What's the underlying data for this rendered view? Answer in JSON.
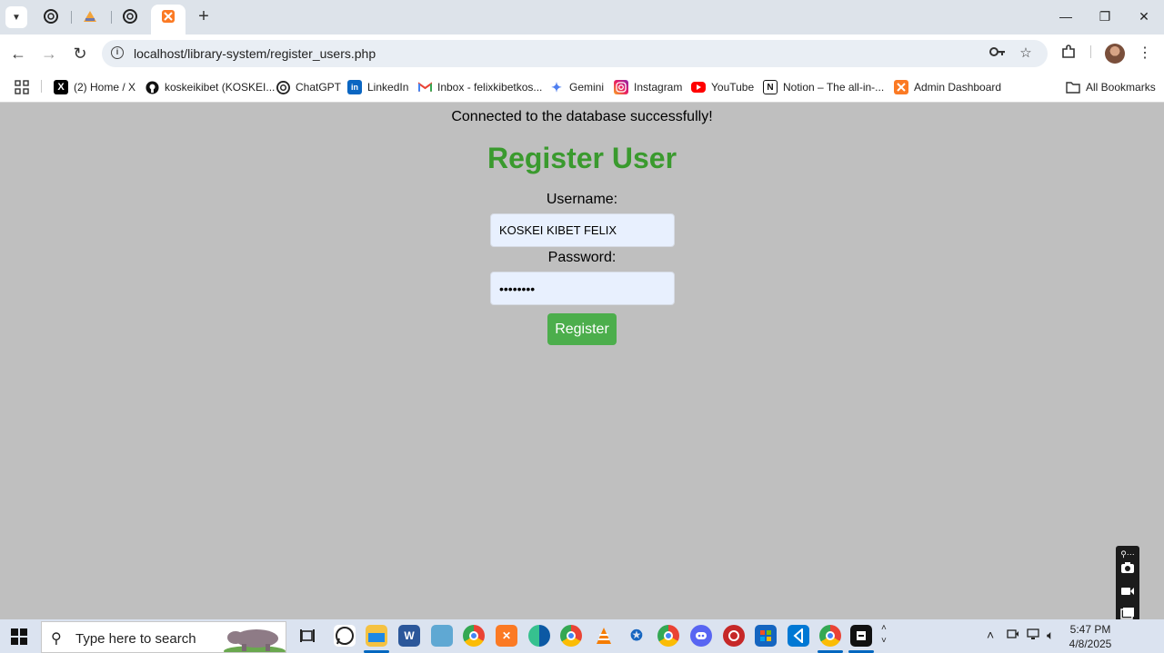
{
  "browser": {
    "url": "localhost/library-system/register_users.php",
    "bookmarks": [
      {
        "label": "(2) Home / X",
        "icon": "x-logo-icon"
      },
      {
        "label": "koskeikibet (KOSKEI...",
        "icon": "github-icon"
      },
      {
        "label": "ChatGPT",
        "icon": "chatgpt-icon"
      },
      {
        "label": "LinkedIn",
        "icon": "linkedin-icon"
      },
      {
        "label": "Inbox - felixkibetkos...",
        "icon": "gmail-icon"
      },
      {
        "label": "Gemini",
        "icon": "gemini-icon"
      },
      {
        "label": "Instagram",
        "icon": "instagram-icon"
      },
      {
        "label": "YouTube",
        "icon": "youtube-icon"
      },
      {
        "label": "Notion – The all-in-...",
        "icon": "notion-icon"
      },
      {
        "label": "Admin Dashboard",
        "icon": "xampp-icon"
      }
    ],
    "all_bookmarks_label": "All Bookmarks"
  },
  "page": {
    "status_message": "Connected to the database successfully!",
    "title": "Register User",
    "username_label": "Username:",
    "username_value": "KOSKEI KIBET FELIX",
    "password_label": "Password:",
    "password_value": "••••••••",
    "register_button": "Register"
  },
  "taskbar": {
    "search_placeholder": "Type here to search",
    "time": "5:47 PM",
    "date": "4/8/2025"
  },
  "colors": {
    "title_green": "#3a9a2e",
    "button_green": "#4cae4c",
    "page_background": "#bfbfbf",
    "input_background": "#e8f0fe"
  }
}
